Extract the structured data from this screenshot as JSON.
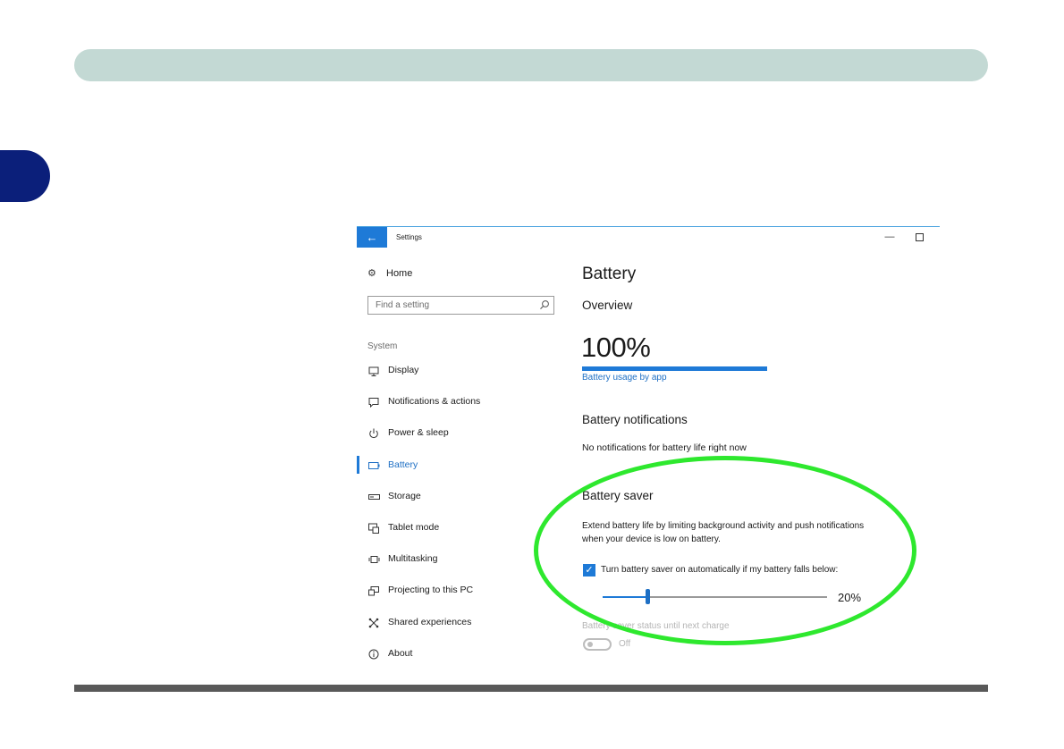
{
  "accent_color": "#1e7ad7",
  "highlight_color": "#2ee82e",
  "window": {
    "title": "Settings",
    "back_icon": "back-arrow-icon",
    "minimize_glyph": "—",
    "maximize_icon": "maximize-icon"
  },
  "sidebar": {
    "home_label": "Home",
    "search_placeholder": "Find a setting",
    "section_label": "System",
    "items": [
      {
        "label": "Display",
        "icon": "display-icon"
      },
      {
        "label": "Notifications & actions",
        "icon": "notifications-icon"
      },
      {
        "label": "Power & sleep",
        "icon": "power-icon"
      },
      {
        "label": "Battery",
        "icon": "battery-icon",
        "active": true
      },
      {
        "label": "Storage",
        "icon": "storage-icon"
      },
      {
        "label": "Tablet mode",
        "icon": "tablet-mode-icon"
      },
      {
        "label": "Multitasking",
        "icon": "multitasking-icon"
      },
      {
        "label": "Projecting to this PC",
        "icon": "projecting-icon"
      },
      {
        "label": "Shared experiences",
        "icon": "shared-experiences-icon"
      },
      {
        "label": "About",
        "icon": "info-icon"
      }
    ]
  },
  "main": {
    "title": "Battery",
    "overview_heading": "Overview",
    "battery_percent_text": "100%",
    "battery_level": 1.0,
    "usage_link": "Battery usage by app",
    "notifications_heading": "Battery notifications",
    "notifications_text": "No notifications for battery life right now",
    "saver_heading": "Battery saver",
    "saver_description": "Extend battery life by limiting background activity and push notifications when your device is low on battery.",
    "auto_checkbox_label": "Turn battery saver on automatically if my battery falls below:",
    "auto_checkbox_checked": true,
    "threshold_percent": 20,
    "threshold_text": "20%",
    "status_label": "Battery saver status until next charge",
    "status_toggle_text": "Off"
  }
}
